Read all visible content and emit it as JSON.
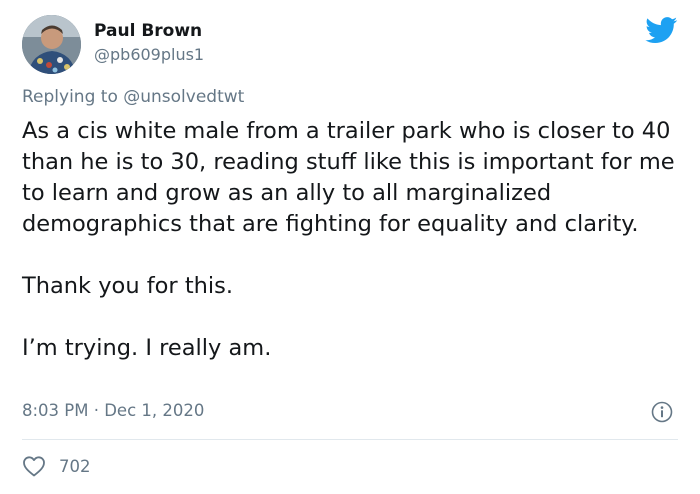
{
  "tweet": {
    "author": {
      "display_name": "Paul Brown",
      "handle": "@pb609plus1"
    },
    "reply": {
      "prefix": "Replying to ",
      "mention": "@unsolvedtwt"
    },
    "body": {
      "paragraph_1": "As a cis white male from a trailer park who is closer to 40 than he is to 30, reading stuff like this is important for me to learn and grow as an ally to all marginalized demographics that are fighting for equality and clarity.",
      "paragraph_2": "Thank you for this.",
      "paragraph_3": "I’m trying. I really am."
    },
    "timestamp": "8:03 PM · Dec 1, 2020",
    "likes": {
      "count": "702"
    }
  },
  "icons": {
    "brand": "twitter-bird-icon",
    "info": "info-icon",
    "like": "heart-icon"
  },
  "colors": {
    "twitter_blue": "#1da1f2",
    "secondary_text": "#657786",
    "primary_text": "#14171a",
    "divider": "#e1e8ed"
  }
}
